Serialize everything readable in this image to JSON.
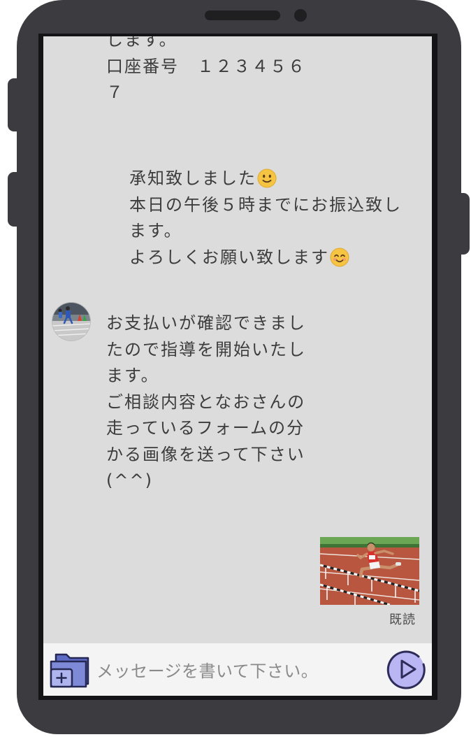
{
  "colors": {
    "phone_body": "#3b3b40",
    "screen_background": "#dcdcdc",
    "input_bar_background": "#f4f4f4",
    "message_text": "#3c3c3c",
    "placeholder_text": "#8a8a8a",
    "send_button": "#bab6f3",
    "folder_icon": "#7e8ad8"
  },
  "chat": {
    "messages": [
      {
        "outgoing": false,
        "lines": [
          "します。",
          "口座番号　１２３４５６",
          "７"
        ]
      },
      {
        "outgoing": true,
        "lines": [
          "承知致しました",
          "本日の午後５時までにお振込致し",
          "ます。",
          "よろしくお願い致します"
        ],
        "line_emoji": [
          "slightly-smiling-face-icon",
          null,
          null,
          "smiling-face-with-smiling-eyes-icon"
        ]
      },
      {
        "outgoing": false,
        "has_avatar": true,
        "lines": [
          "お支払いが確認できまし",
          "たので指導を開始いたし",
          "ます。",
          "ご相談内容となおさんの",
          "走っているフォームの分",
          "かる画像を送って下さい",
          "(^^)"
        ]
      },
      {
        "outgoing": true,
        "has_photo": true,
        "read_receipt": "既読"
      }
    ]
  },
  "input_bar": {
    "attach_icon": "folder-plus-icon",
    "placeholder": "メッセージを書いて下さい。",
    "send_icon": "send-play-icon"
  }
}
